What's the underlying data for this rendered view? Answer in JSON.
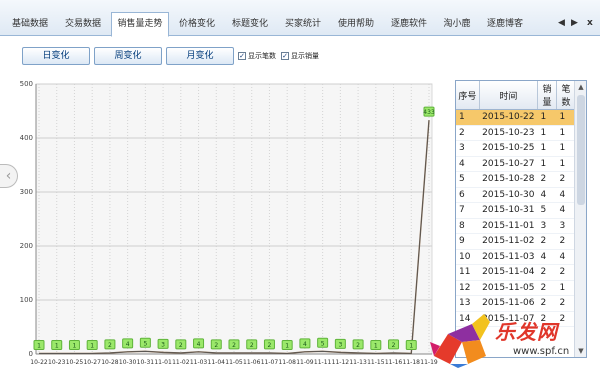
{
  "tabs": [
    {
      "label": "基础数据",
      "active": false
    },
    {
      "label": "交易数据",
      "active": false
    },
    {
      "label": "销售量走势",
      "active": true
    },
    {
      "label": "价格变化",
      "active": false
    },
    {
      "label": "标题变化",
      "active": false
    },
    {
      "label": "买家统计",
      "active": false
    },
    {
      "label": "使用帮助",
      "active": false
    },
    {
      "label": "逐鹿软件",
      "active": false
    },
    {
      "label": "淘小鹿",
      "active": false
    },
    {
      "label": "逐鹿博客",
      "active": false
    }
  ],
  "tab_controls": {
    "prev": "◀",
    "next": "▶",
    "close": "x"
  },
  "toolbar": {
    "day_button": "日变化",
    "week_button": "周变化",
    "month_button": "月变化",
    "show_count_label": "显示笔数",
    "show_count_checked": true,
    "show_sales_label": "显示销量",
    "show_sales_checked": true
  },
  "side_arrow": "‹",
  "chart_data": {
    "type": "line",
    "x": [
      "10-22",
      "10-23",
      "10-25",
      "10-27",
      "10-28",
      "10-30",
      "10-31",
      "11-01",
      "11-02",
      "11-03",
      "11-04",
      "11-05",
      "11-06",
      "11-07",
      "11-08",
      "11-09",
      "11-11",
      "11-12",
      "11-13",
      "11-15",
      "11-16",
      "11-18",
      "11-19"
    ],
    "series": [
      {
        "values": [
          1,
          1,
          1,
          1,
          2,
          4,
          5,
          3,
          2,
          4,
          2,
          2,
          2,
          2,
          1,
          4,
          5,
          3,
          2,
          1,
          2,
          1,
          433
        ],
        "color": "#8b6a4a"
      },
      {
        "values": [
          1,
          1,
          1,
          1,
          2,
          4,
          5,
          3,
          2,
          4,
          2,
          2,
          2,
          2,
          1,
          4,
          5,
          3,
          2,
          1,
          2,
          1,
          433
        ],
        "color": "#555555"
      }
    ],
    "data_labels": [
      "1",
      "1",
      "1",
      "1",
      "2",
      "4",
      "5",
      "3",
      "2",
      "4",
      "2",
      "2",
      "2",
      "2",
      "1",
      "4",
      "5",
      "3",
      "2",
      "1",
      "2",
      "1",
      "433"
    ],
    "ylim": [
      0,
      500
    ],
    "yticks": [
      "0",
      "100",
      "200",
      "300",
      "400",
      "500"
    ],
    "xticks": [
      "10-22",
      "10-23",
      "10-25",
      "10-27",
      "10-28",
      "10-30",
      "10-31",
      "11-01",
      "11-02",
      "11-03",
      "11-04",
      "11-05",
      "11-06",
      "11-07",
      "11-08",
      "11-09",
      "11-11",
      "11-12",
      "11-13",
      "11-15",
      "11-16",
      "11-18",
      "11-19"
    ],
    "grid": true
  },
  "table": {
    "headers": [
      "序号",
      "时间",
      "销量",
      "笔数"
    ],
    "rows": [
      [
        "1",
        "2015-10-22",
        "1",
        "1"
      ],
      [
        "2",
        "2015-10-23",
        "1",
        "1"
      ],
      [
        "3",
        "2015-10-25",
        "1",
        "1"
      ],
      [
        "4",
        "2015-10-27",
        "1",
        "1"
      ],
      [
        "5",
        "2015-10-28",
        "2",
        "2"
      ],
      [
        "6",
        "2015-10-30",
        "4",
        "4"
      ],
      [
        "7",
        "2015-10-31",
        "5",
        "4"
      ],
      [
        "8",
        "2015-11-01",
        "3",
        "3"
      ],
      [
        "9",
        "2015-11-02",
        "2",
        "2"
      ],
      [
        "10",
        "2015-11-03",
        "4",
        "4"
      ],
      [
        "11",
        "2015-11-04",
        "2",
        "2"
      ],
      [
        "12",
        "2015-11-05",
        "2",
        "1"
      ],
      [
        "13",
        "2015-11-06",
        "2",
        "2"
      ],
      [
        "14",
        "2015-11-07",
        "2",
        "2"
      ]
    ],
    "selected_row": 0
  },
  "watermark": {
    "text": "乐发网",
    "url": "www.spf.cn"
  }
}
